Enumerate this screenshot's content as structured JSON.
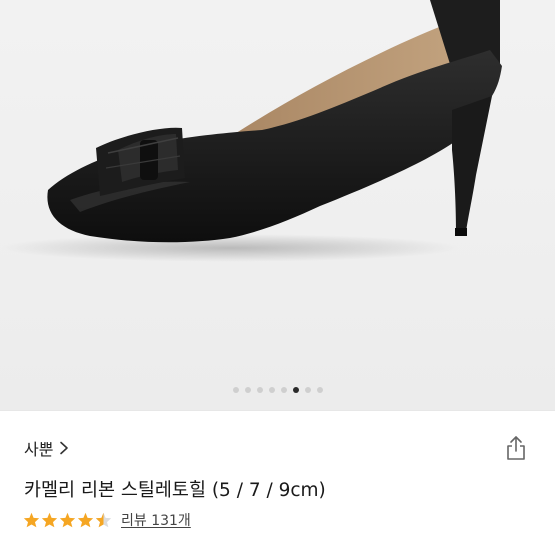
{
  "gallery": {
    "total_images": 8,
    "current_index": 5
  },
  "store": {
    "name": "사뿐",
    "chevron_icon": "chevron-right-icon"
  },
  "share_icon": "share-icon",
  "product": {
    "title": "카멜리 리본 스틸레토힐 (5 / 7 / 9cm)"
  },
  "rating": {
    "stars": 4.5,
    "star_color": "#f5a623",
    "review_label": "리뷰 131개"
  }
}
